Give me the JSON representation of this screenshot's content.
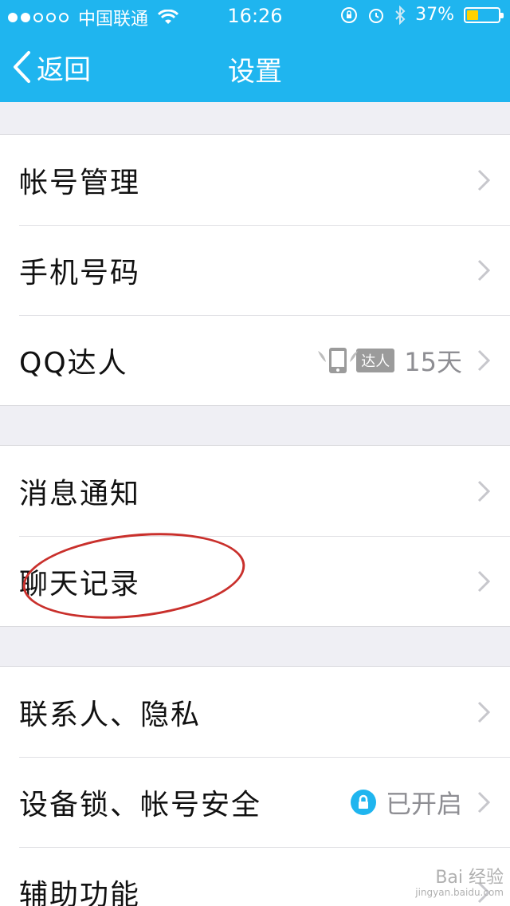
{
  "status_bar": {
    "carrier": "中国联通",
    "time": "16:26",
    "battery_percent": "37%",
    "battery_level": 0.37,
    "signal_bars": 2
  },
  "nav": {
    "back_label": "返回",
    "title": "设置"
  },
  "groups": [
    {
      "rows": [
        {
          "label": "帐号管理"
        },
        {
          "label": "手机号码"
        },
        {
          "label": "QQ达人",
          "badge": "达人",
          "value": "15天"
        }
      ]
    },
    {
      "rows": [
        {
          "label": "消息通知"
        },
        {
          "label": "聊天记录"
        }
      ]
    },
    {
      "rows": [
        {
          "label": "联系人、隐私"
        },
        {
          "label": "设备锁、帐号安全",
          "value": "已开启"
        },
        {
          "label": "辅助功能"
        }
      ]
    }
  ],
  "watermark": {
    "brand": "Bai 经验",
    "url": "jingyan.baidu.com"
  },
  "colors": {
    "accent": "#1fb5ef",
    "annotation": "#c9302c",
    "background": "#efeff4"
  }
}
